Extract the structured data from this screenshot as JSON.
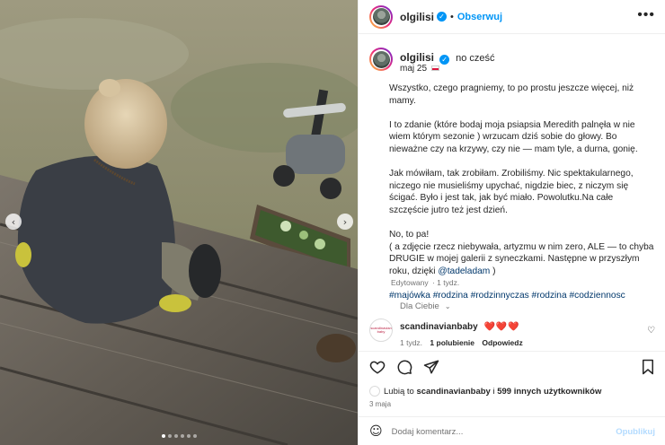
{
  "post": {
    "username": "olgilisi",
    "follow_label": "Obserwuj",
    "more_label": "•••",
    "location": "no cześć",
    "date": "maj 25",
    "caption": [
      "Wszystko, czego pragniemy, to po prostu jeszcze więcej, niż mamy.",
      "I to zdanie (które bodaj moja psiapsia Meredith palnęła w nie wiem którym sezonie ) wrzucam dziś sobie do głowy. Bo nieważne czy na krzywy, czy nie — mam tyle, a durna, gonię.",
      "Jak mówiłam, tak zrobiłam. Zrobiliśmy. Nic spektakularnego, niczego nie musieliśmy upychać, nigdzie biec, z niczym się ścigać. Było i jest tak, jak być miało. Powolutku.Na całe szczęście jutro też jest dzień."
    ],
    "caption_last_a": "No, to pa!",
    "caption_last_b": "( a zdjęcie rzecz niebywała, artyzmu w nim zero, ALE — to chyba DRUGIE w mojej galerii z syneczkami. Następne w przyszłym roku, dzięki",
    "caption_mention": "@tadeladam",
    "caption_last_c": ")",
    "hashtags": "#majówka #rodzina #rodzinnyczas #rodzina #codziennosc",
    "edited_label": "Edytowany",
    "edited_time": "· 1 tydz."
  },
  "for_you": "Dla Ciebie",
  "comment": {
    "avatar_text": "scandinavian baby",
    "username": "scandinavianbaby",
    "text": "❤️❤️❤️",
    "time": "1 tydz.",
    "likes": "1 polubienie",
    "reply": "Odpowiedz"
  },
  "likes": {
    "prefix": "Lubią to",
    "user": "scandinavianbaby",
    "middle": "i",
    "others": "599 innych użytkowników"
  },
  "post_date": "3 maja",
  "add_comment": {
    "placeholder": "Dodaj komentarz...",
    "post_label": "Opublikuj"
  },
  "icons": {
    "verified": "verified-badge-icon",
    "heart": "heart-icon",
    "comment": "comment-icon",
    "share": "share-icon",
    "save": "bookmark-icon",
    "emoji": "emoji-icon"
  },
  "colors": {
    "accent": "#0095f6",
    "link": "#00376b",
    "muted": "#737373"
  },
  "carousel": {
    "slides": 6,
    "active": 0
  }
}
